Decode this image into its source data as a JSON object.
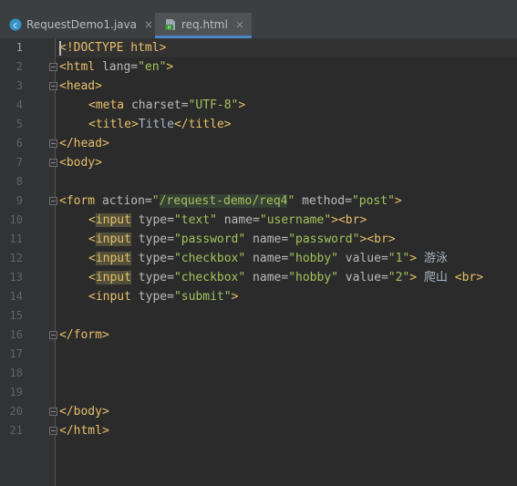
{
  "tabs": [
    {
      "label": "RequestDemo1.java",
      "icon": "java-class-icon",
      "active": false
    },
    {
      "label": "req.html",
      "icon": "html-file-icon",
      "active": true
    }
  ],
  "tab_close_glyph": "×",
  "line_numbers": [
    "1",
    "2",
    "3",
    "4",
    "5",
    "6",
    "7",
    "8",
    "9",
    "10",
    "11",
    "12",
    "13",
    "14",
    "15",
    "16",
    "17",
    "18",
    "19",
    "20",
    "21"
  ],
  "current_line": 1,
  "code": {
    "l1": {
      "p1": "<!DOCTYPE html",
      "p2": ">"
    },
    "l2": {
      "open": "<html",
      "attr": " lang=",
      "val": "\"en\"",
      "close": ">"
    },
    "l3": {
      "t": "<head>"
    },
    "l4": {
      "open": "<meta",
      "attr": " charset=",
      "val": "\"UTF-8\"",
      "close": ">"
    },
    "l5": {
      "open": "<title>",
      "text": "Title",
      "close": "</title>"
    },
    "l6": {
      "t": "</head>"
    },
    "l7": {
      "t": "<body>"
    },
    "l9": {
      "open": "<form",
      "a1": " action=",
      "q1": "\"",
      "v1": "/request-demo/req4",
      "q2": "\"",
      "a2": " method=",
      "v2": "\"post\"",
      "close": ">"
    },
    "l10": {
      "lt": "<",
      "name": "input",
      "a1": " type=",
      "v1": "\"text\"",
      "a2": " name=",
      "v2": "\"username\"",
      "close": "><br>"
    },
    "l11": {
      "lt": "<",
      "name": "input",
      "a1": " type=",
      "v1": "\"password\"",
      "a2": " name=",
      "v2": "\"password\"",
      "close": "><br>"
    },
    "l12": {
      "lt": "<",
      "name": "input",
      "a1": " type=",
      "v1": "\"checkbox\"",
      "a2": " name=",
      "v2": "\"hobby\"",
      "a3": " value=",
      "v3": "\"1\"",
      "close": ">",
      "text": " 游泳"
    },
    "l13": {
      "lt": "<",
      "name": "input",
      "a1": " type=",
      "v1": "\"checkbox\"",
      "a2": " name=",
      "v2": "\"hobby\"",
      "a3": " value=",
      "v3": "\"2\"",
      "close": ">",
      "text": " 爬山 ",
      "br": "<br>"
    },
    "l14": {
      "open": "<input",
      "a1": " type=",
      "v1": "\"submit\"",
      "close": ">"
    },
    "l16": {
      "t": "</form>"
    },
    "l20": {
      "t": "</body>"
    },
    "l21": {
      "t": "</html>"
    }
  },
  "colors": {
    "background": "#2b2b2b",
    "tag": "#e8bf6a",
    "attribute": "#bababa",
    "value": "#a5c25c",
    "text": "#a9b7c6",
    "active_tab_underline": "#4a88c7"
  }
}
